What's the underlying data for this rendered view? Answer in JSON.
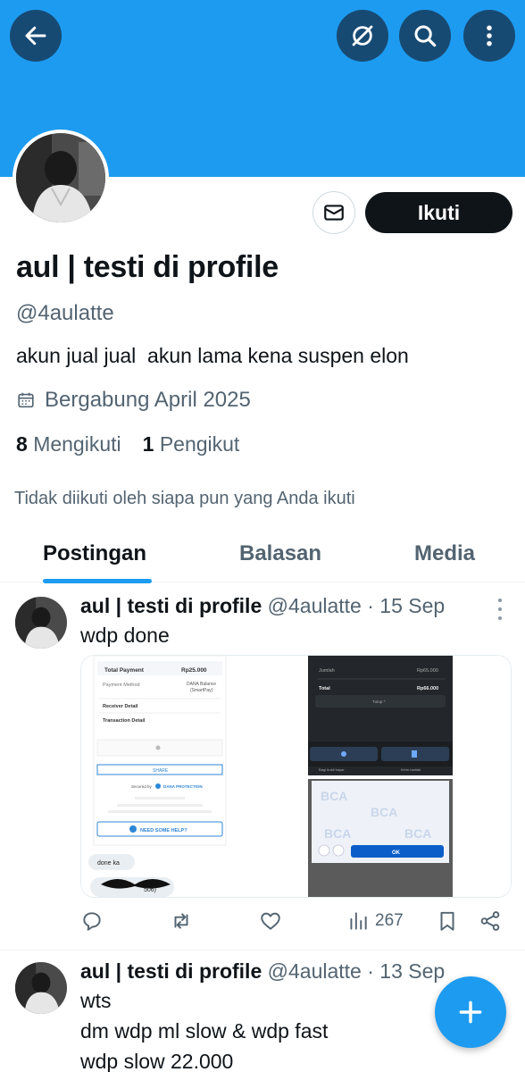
{
  "header": {
    "banner_color": "#1d9bf0",
    "back_icon": "arrow-left-icon",
    "actions": [
      "grok-icon",
      "search-icon",
      "more-vertical-icon"
    ]
  },
  "profile": {
    "name": "aul | testi di profile",
    "handle": "@4aulatte",
    "bio": "akun jual jual  akun lama kena suspen elon",
    "joined": "Bergabung April 2025",
    "following_count": "8",
    "following_label": "Mengikuti",
    "followers_count": "1",
    "followers_label": "Pengikut",
    "not_followed_note": "Tidak diikuti oleh siapa pun yang Anda ikuti",
    "follow_button": "Ikuti"
  },
  "tabs": [
    {
      "label": "Postingan",
      "active": true
    },
    {
      "label": "Balasan",
      "active": false
    },
    {
      "label": "Media",
      "active": false
    }
  ],
  "posts": [
    {
      "name": "aul | testi di profile",
      "meta": "@4aulatte · 15 Sep",
      "text": "wdp done",
      "media": {
        "left": {
          "total_label": "Total Payment",
          "total_value": "Rp25.000",
          "method_label": "Payment Method",
          "method_value_1": "DANA Balance",
          "method_value_2": "(SmartPay)",
          "receiver": "Receiver Detail",
          "transaction": "Transaction Detail",
          "share": "SHARE",
          "secured": "Secured by",
          "dana": "DANA PROTECTION",
          "help": "NEED SOME HELP?",
          "chat1": "done ka",
          "chat2": "506)"
        },
        "right_top": {
          "jumlah_label": "Jumlah",
          "jumlah_value": "Rp65.000",
          "total_label": "Total",
          "total_value": "Rp66.000",
          "tutup": "Tutup ^",
          "btn1": "Bagi bukti bayar",
          "btn2": "Kirim hadiah"
        },
        "right_bottom": {
          "bank": "BCA",
          "ok": "OK"
        }
      },
      "views": "267"
    },
    {
      "name": "aul | testi di profile",
      "meta": "@4aulatte · 13 Sep",
      "line1": "wts",
      "line2": "dm wdp ml slow & wdp fast",
      "line3": "wdp slow 22.000"
    }
  ],
  "fab_icon": "plus-icon"
}
